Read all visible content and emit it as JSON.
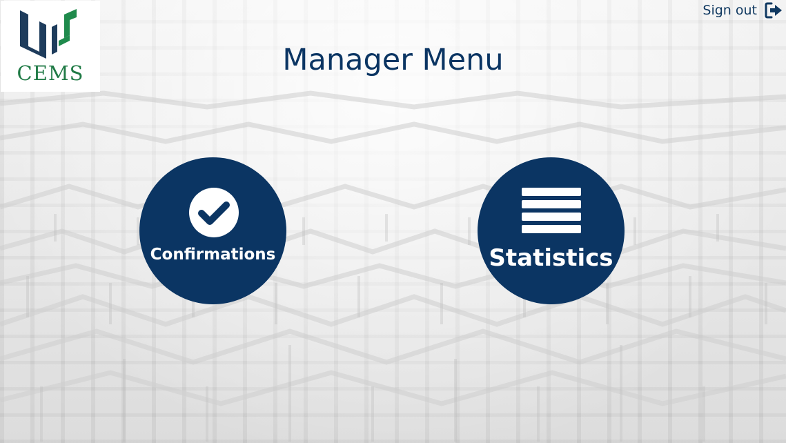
{
  "logo": {
    "text": "CEMS",
    "colors": {
      "dark": "#1e3c5c",
      "green": "#1f8a4c"
    }
  },
  "header": {
    "signout_label": "Sign out",
    "signout_icon": "sign-out-icon"
  },
  "page": {
    "title": "Manager Menu"
  },
  "menu": {
    "confirmations": {
      "label": "Confirmations",
      "icon": "check-circle-icon"
    },
    "statistics": {
      "label": "Statistics",
      "icon": "list-icon"
    }
  },
  "colors": {
    "primary": "#0b3563",
    "button_text": "#ffffff",
    "background": "#e9e9e9"
  }
}
